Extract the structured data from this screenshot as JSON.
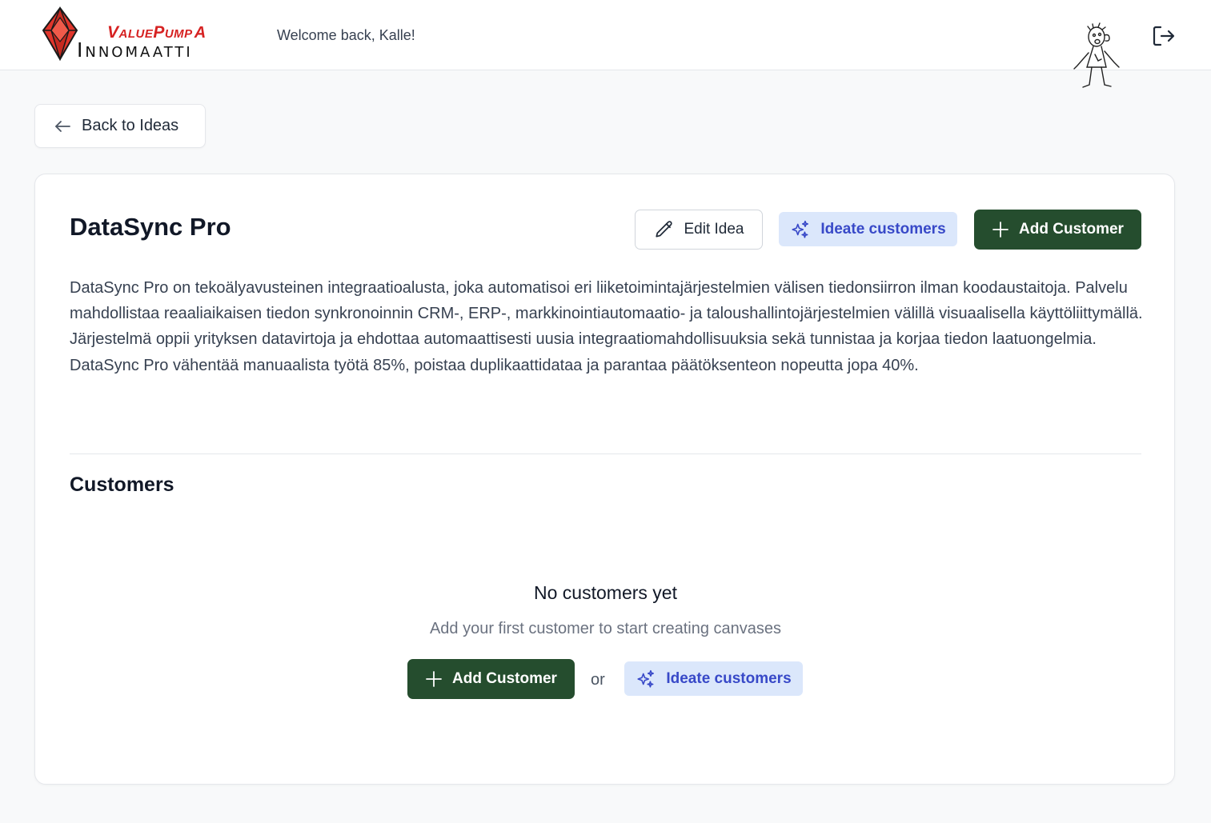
{
  "header": {
    "brand_top": "ValuePump",
    "brand_alpha": "α",
    "brand_bottom": "Innomaatti",
    "welcome": "Welcome back, Kalle!",
    "logout_icon": "logout-icon"
  },
  "nav": {
    "back_label": "Back to Ideas"
  },
  "idea": {
    "title": "DataSync Pro",
    "description": "DataSync Pro on tekoälyavusteinen integraatioalusta, joka automatisoi eri liiketoimintajärjestelmien välisen tiedonsiirron ilman koodaustaitoja. Palvelu mahdollistaa reaaliaikaisen tiedon synkronoinnin CRM-, ERP-, markkinointiautomaatio- ja taloushallintojärjestelmien välillä visuaalisella käyttöliittymällä. Järjestelmä oppii yrityksen datavirtoja ja ehdottaa automaattisesti uusia integraatiomahdollisuuksia sekä tunnistaa ja korjaa tiedon laatuongelmia. DataSync Pro vähentää manuaalista työtä 85%, poistaa duplikaattidataa ja parantaa päätöksenteon nopeutta jopa 40%.",
    "edit_label": "Edit Idea",
    "ideate_label": "Ideate customers",
    "add_customer_label": "Add Customer"
  },
  "customers": {
    "title": "Customers",
    "empty_title": "No customers yet",
    "empty_subtitle": "Add your first customer to start creating canvases",
    "add_customer_label": "Add Customer",
    "or_label": "or",
    "ideate_label": "Ideate customers"
  },
  "colors": {
    "primary_green": "#254d2e",
    "ideate_bg": "#dbe7fb",
    "ideate_text": "#3849c8",
    "brand_red": "#d62222"
  }
}
